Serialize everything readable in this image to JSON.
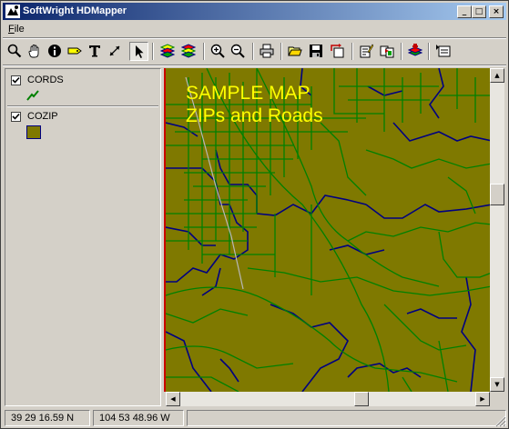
{
  "window": {
    "title": "SoftWright HDMapper",
    "minimize_label": "_",
    "maximize_label": "□",
    "close_label": "×"
  },
  "menu": {
    "items": [
      {
        "label": "File",
        "accel": "F",
        "rest": "ile"
      }
    ]
  },
  "toolbar": {
    "buttons": [
      {
        "icon": "zoom-magnifier-icon"
      },
      {
        "icon": "pan-hand-icon"
      },
      {
        "icon": "info-icon"
      },
      {
        "icon": "label-tag-icon"
      },
      {
        "icon": "text-tool-icon",
        "glyph": "T"
      },
      {
        "icon": "measure-line-icon"
      },
      {
        "icon": "select-arrow-icon",
        "pressed": true
      },
      {
        "icon": "layers-icon"
      },
      {
        "icon": "layers-properties-icon"
      },
      {
        "icon": "zoom-in-icon"
      },
      {
        "icon": "zoom-out-icon"
      },
      {
        "icon": "print-icon"
      },
      {
        "icon": "open-folder-icon"
      },
      {
        "icon": "save-icon"
      },
      {
        "icon": "export-icon"
      },
      {
        "icon": "edit-properties-icon"
      },
      {
        "icon": "copy-layer-icon"
      },
      {
        "icon": "add-layer-icon"
      },
      {
        "icon": "layer-list-icon"
      }
    ]
  },
  "legend": {
    "layers": [
      {
        "name": "CORDS",
        "checked": true,
        "check_mark": "✓",
        "symbol": "line",
        "color": "#008000"
      },
      {
        "name": "COZIP",
        "checked": true,
        "check_mark": "✓",
        "symbol": "polygon",
        "fill": "#7f7900",
        "stroke": "#000080"
      }
    ]
  },
  "map": {
    "title_line1": "SAMPLE MAP",
    "title_line2": "ZIPs and Roads",
    "fill_color": "#7f7900",
    "road_color": "#008000",
    "zip_boundary_color": "#000080",
    "title_color": "#ffff00",
    "vertical_scroll_position": 0.37,
    "horizontal_scroll_position": 0.62
  },
  "status": {
    "latitude": "39 29 16.59 N",
    "longitude": "104 53 48.96 W",
    "extra": ""
  }
}
